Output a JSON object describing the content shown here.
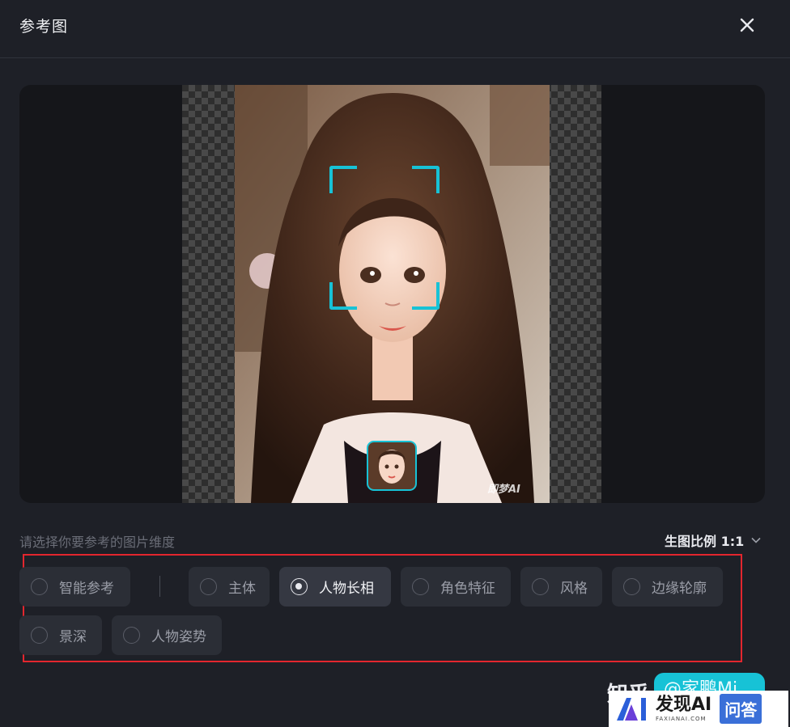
{
  "dialog": {
    "title": "参考图",
    "close_icon": "close-icon"
  },
  "preview": {
    "watermark": "即梦AI",
    "accent_color": "#17c2d6"
  },
  "options": {
    "prompt": "请选择你要参考的图片维度",
    "ratio_label": "生图比例 1:1",
    "chips": [
      {
        "label": "智能参考",
        "selected": false
      },
      {
        "label": "主体",
        "selected": false
      },
      {
        "label": "人物长相",
        "selected": true
      },
      {
        "label": "角色特征",
        "selected": false
      },
      {
        "label": "风格",
        "selected": false
      },
      {
        "label": "边缘轮廓",
        "selected": false
      },
      {
        "label": "景深",
        "selected": false
      },
      {
        "label": "人物姿势",
        "selected": false
      }
    ],
    "highlight_color": "#e3262e"
  },
  "watermarks": {
    "zhihu": "知乎",
    "zhihu_user": "@家鹏Mi",
    "faxian_name": "发现AI",
    "faxian_domain": "FAXIANAI.COM",
    "faxian_tag": "问答"
  }
}
